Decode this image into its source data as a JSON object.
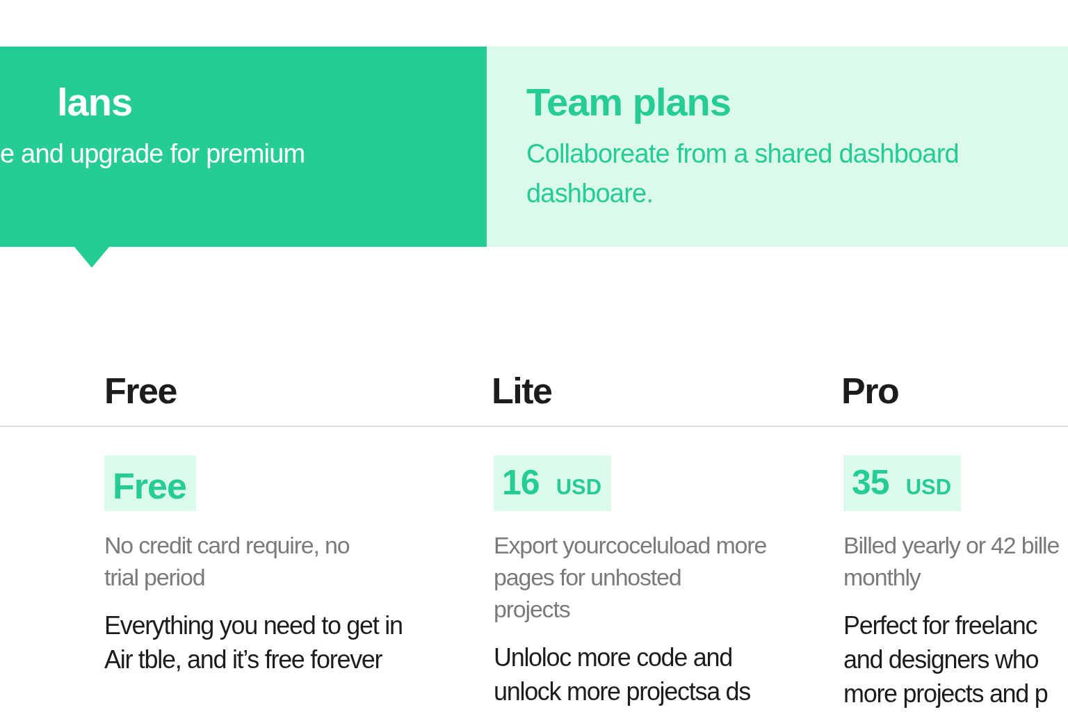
{
  "tabs": [
    {
      "title": "lans",
      "subtitle": [
        "e and upgrade for premium"
      ],
      "selected": true
    },
    {
      "title": "Team plans",
      "subtitle": [
        "Collaboreate from a  shared dashboard",
        "dashboare."
      ],
      "selected": false
    }
  ],
  "plans": [
    {
      "name": "Free",
      "price": {
        "amount": "Free"
      },
      "note": [
        "No credit card require, no",
        "trial period"
      ],
      "description": [
        "Everything you need to get in",
        "Air tble, and it’s free forever"
      ]
    },
    {
      "name": "Lite",
      "price": {
        "amount": "16",
        "currency": "USD"
      },
      "note": [
        "Export yourcoceluload more",
        "pages for unhosted",
        "projects"
      ],
      "description": [
        "Unloloc more code and",
        "unlock more projectsa ds"
      ]
    },
    {
      "name": "Pro",
      "price": {
        "amount": "35",
        "currency": "USD"
      },
      "note": [
        "Billed yearly or 42 bille",
        "monthly"
      ],
      "description": [
        "Perfect for freelanc",
        "and designers who",
        "more projects and p"
      ]
    }
  ]
}
